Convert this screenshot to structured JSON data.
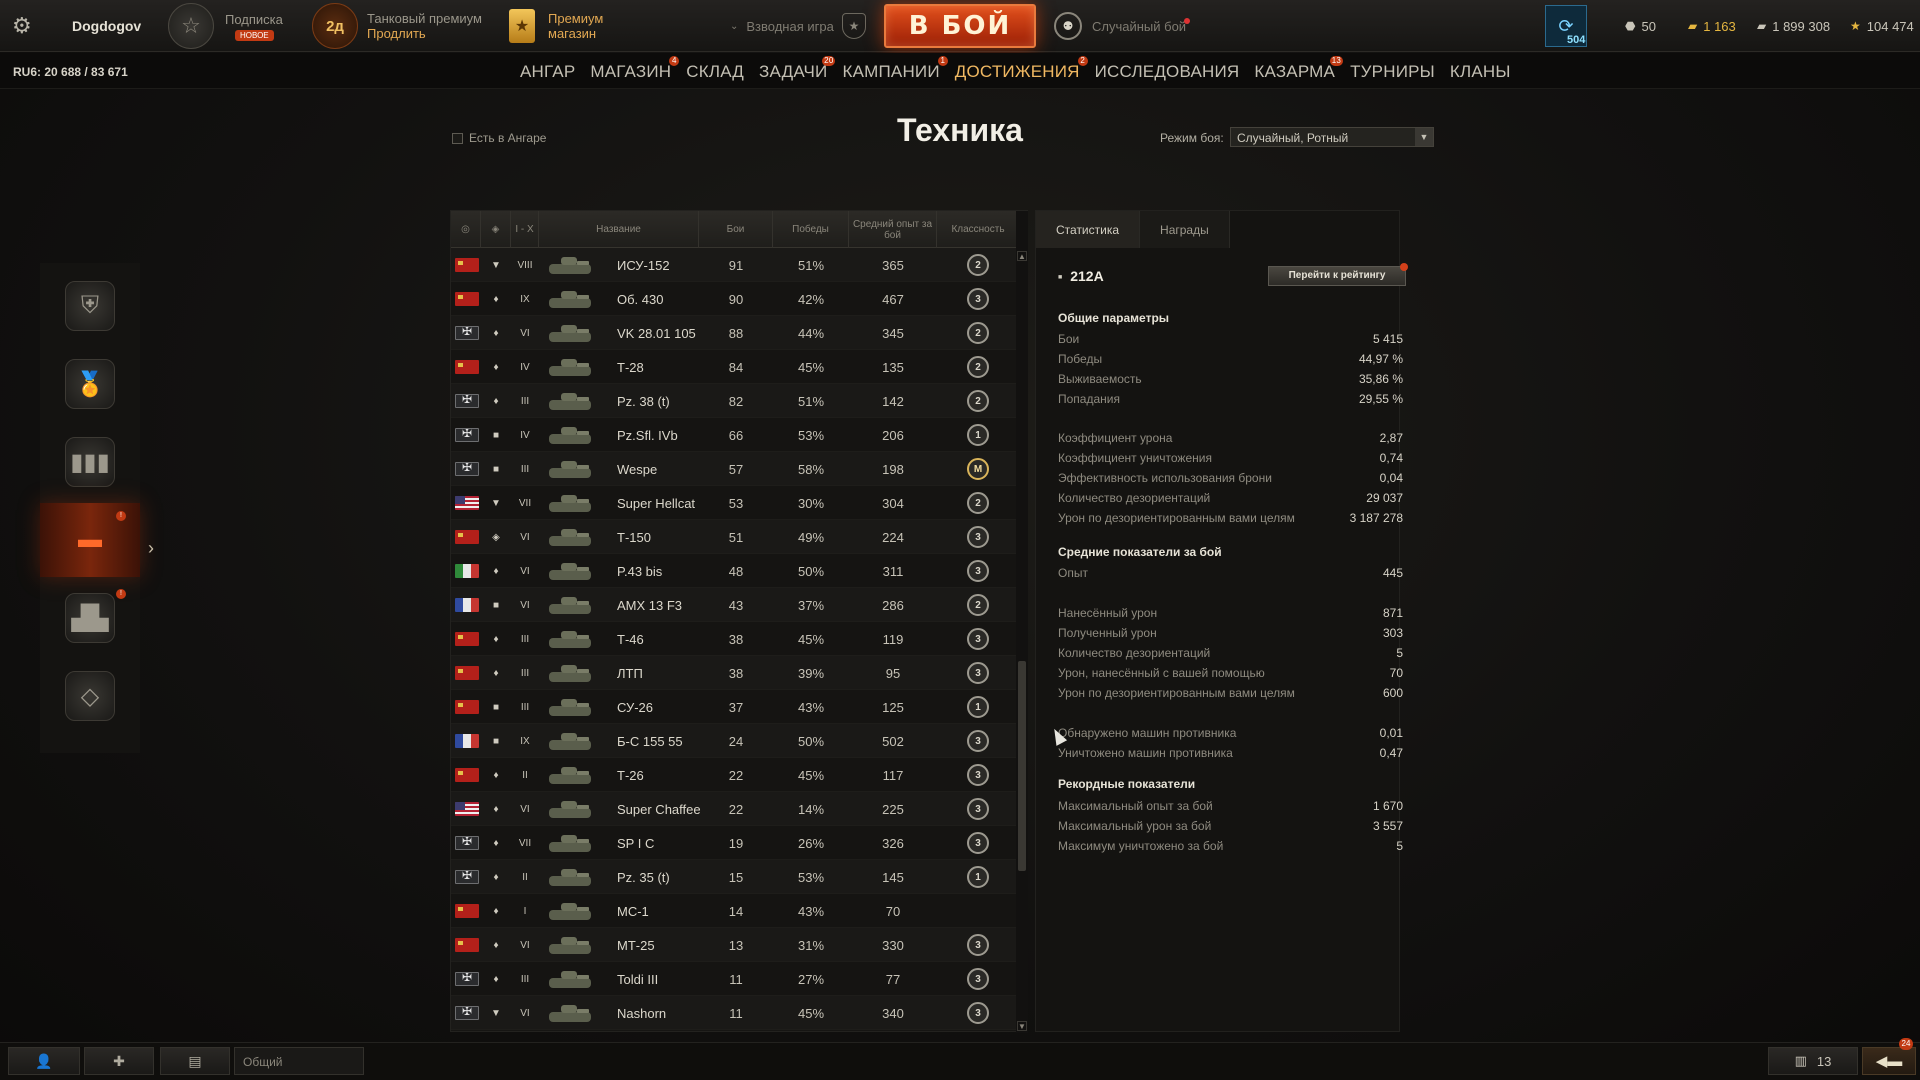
{
  "topbar": {
    "username": "Dogdogov",
    "subscription_label": "Подписка",
    "subscription_badge": "НОВОЕ",
    "premium_days": "2д",
    "premium_label": "Танковый премиум",
    "premium_action": "Продлить",
    "shop_line1": "Премиум",
    "shop_line2": "магазин",
    "platoon_label": "Взводная игра",
    "battle_button": "В БОЙ",
    "battle_mode": "Случайный бой",
    "session_count": "504",
    "currencies": [
      {
        "symbol": "⬣",
        "value": "50",
        "color": "#c9c5b9"
      },
      {
        "symbol": "▰",
        "value": "1 163",
        "color": "#e5b640"
      },
      {
        "symbol": "▰",
        "value": "1 899 308",
        "color": "#c9c5b9"
      },
      {
        "symbol": "★",
        "value": "104 474",
        "color": "#e5b640"
      }
    ]
  },
  "rating_text": "RU6: 20 688 / 83 671",
  "nav": [
    {
      "label": "АНГАР",
      "badge": ""
    },
    {
      "label": "МАГАЗИН",
      "badge": "4"
    },
    {
      "label": "СКЛАД",
      "badge": ""
    },
    {
      "label": "ЗАДАЧИ",
      "badge": "20"
    },
    {
      "label": "КАМПАНИИ",
      "badge": "1"
    },
    {
      "label": "ДОСТИЖЕНИЯ",
      "badge": "2",
      "active": true
    },
    {
      "label": "ИССЛЕДОВАНИЯ",
      "badge": ""
    },
    {
      "label": "КАЗАРМА",
      "badge": "13"
    },
    {
      "label": "ТУРНИРЫ",
      "badge": ""
    },
    {
      "label": "КЛАНЫ",
      "badge": ""
    }
  ],
  "header": {
    "in_hangar_label": "Есть в Ангаре",
    "title": "Техника",
    "mode_label": "Режим боя:",
    "mode_value": "Случайный, Ротный"
  },
  "table": {
    "columns": {
      "tier": "I - X",
      "name": "Название",
      "battles": "Бои",
      "wins": "Победы",
      "avg_xp": "Средний опыт за бой",
      "mastery": "Классность"
    },
    "rows": [
      {
        "nation": "ussr",
        "type": "▼",
        "tier": "VIII",
        "name": "ИСУ-152",
        "battles": "91",
        "wins": "51%",
        "xp": "365",
        "mastery": "2"
      },
      {
        "nation": "ussr",
        "type": "♦",
        "tier": "IX",
        "name": "Об. 430",
        "battles": "90",
        "wins": "42%",
        "xp": "467",
        "mastery": "3"
      },
      {
        "nation": "ger",
        "type": "♦",
        "tier": "VI",
        "name": "VK 28.01 105",
        "battles": "88",
        "wins": "44%",
        "xp": "345",
        "mastery": "2"
      },
      {
        "nation": "ussr",
        "type": "♦",
        "tier": "IV",
        "name": "Т-28",
        "battles": "84",
        "wins": "45%",
        "xp": "135",
        "mastery": "2"
      },
      {
        "nation": "ger",
        "type": "♦",
        "tier": "III",
        "name": "Pz. 38 (t)",
        "battles": "82",
        "wins": "51%",
        "xp": "142",
        "mastery": "2"
      },
      {
        "nation": "ger",
        "type": "■",
        "tier": "IV",
        "name": "Pz.Sfl. IVb",
        "battles": "66",
        "wins": "53%",
        "xp": "206",
        "mastery": "1"
      },
      {
        "nation": "ger",
        "type": "■",
        "tier": "III",
        "name": "Wespe",
        "battles": "57",
        "wins": "58%",
        "xp": "198",
        "mastery": "M"
      },
      {
        "nation": "usa",
        "type": "▼",
        "tier": "VII",
        "name": "Super Hellcat",
        "battles": "53",
        "wins": "30%",
        "xp": "304",
        "mastery": "2"
      },
      {
        "nation": "ussr",
        "type": "◈",
        "tier": "VI",
        "name": "Т-150",
        "battles": "51",
        "wins": "49%",
        "xp": "224",
        "mastery": "3"
      },
      {
        "nation": "ita",
        "type": "♦",
        "tier": "VI",
        "name": "P.43 bis",
        "battles": "48",
        "wins": "50%",
        "xp": "311",
        "mastery": "3"
      },
      {
        "nation": "fra",
        "type": "■",
        "tier": "VI",
        "name": "AMX 13 F3",
        "battles": "43",
        "wins": "37%",
        "xp": "286",
        "mastery": "2"
      },
      {
        "nation": "ussr",
        "type": "♦",
        "tier": "III",
        "name": "Т-46",
        "battles": "38",
        "wins": "45%",
        "xp": "119",
        "mastery": "3"
      },
      {
        "nation": "ussr",
        "type": "♦",
        "tier": "III",
        "name": "ЛТП",
        "battles": "38",
        "wins": "39%",
        "xp": "95",
        "mastery": "3"
      },
      {
        "nation": "ussr",
        "type": "■",
        "tier": "III",
        "name": "СУ-26",
        "battles": "37",
        "wins": "43%",
        "xp": "125",
        "mastery": "1"
      },
      {
        "nation": "fra",
        "type": "■",
        "tier": "IX",
        "name": "Б-С 155 55",
        "battles": "24",
        "wins": "50%",
        "xp": "502",
        "mastery": "3"
      },
      {
        "nation": "ussr",
        "type": "♦",
        "tier": "II",
        "name": "Т-26",
        "battles": "22",
        "wins": "45%",
        "xp": "117",
        "mastery": "3"
      },
      {
        "nation": "usa",
        "type": "♦",
        "tier": "VI",
        "name": "Super Chaffee",
        "battles": "22",
        "wins": "14%",
        "xp": "225",
        "mastery": "3"
      },
      {
        "nation": "ger",
        "type": "♦",
        "tier": "VII",
        "name": "SP I C",
        "battles": "19",
        "wins": "26%",
        "xp": "326",
        "mastery": "3"
      },
      {
        "nation": "ger",
        "type": "♦",
        "tier": "II",
        "name": "Pz. 35 (t)",
        "battles": "15",
        "wins": "53%",
        "xp": "145",
        "mastery": "1"
      },
      {
        "nation": "ussr",
        "type": "♦",
        "tier": "I",
        "name": "МС-1",
        "battles": "14",
        "wins": "43%",
        "xp": "70",
        "mastery": ""
      },
      {
        "nation": "ussr",
        "type": "♦",
        "tier": "VI",
        "name": "МТ-25",
        "battles": "13",
        "wins": "31%",
        "xp": "330",
        "mastery": "3"
      },
      {
        "nation": "ger",
        "type": "♦",
        "tier": "III",
        "name": "Toldi III",
        "battles": "11",
        "wins": "27%",
        "xp": "77",
        "mastery": "3"
      },
      {
        "nation": "ger",
        "type": "▼",
        "tier": "VI",
        "name": "Nashorn",
        "battles": "11",
        "wins": "45%",
        "xp": "340",
        "mastery": "3"
      }
    ]
  },
  "panel": {
    "tab_stats": "Статистика",
    "tab_awards": "Награды",
    "vehicle": "212A",
    "rating_button": "Перейти к рейтингу",
    "general_title": "Общие параметры",
    "general": [
      {
        "label": "Бои",
        "value": "5 415"
      },
      {
        "label": "Победы",
        "value": "44,97 %"
      },
      {
        "label": "Выживаемость",
        "value": "35,86 %"
      },
      {
        "label": "Попадания",
        "value": "29,55 %"
      }
    ],
    "coeffs": [
      {
        "label": "Коэффициент урона",
        "value": "2,87"
      },
      {
        "label": "Коэффициент уничтожения",
        "value": "0,74"
      },
      {
        "label": "Эффективность использования брони",
        "value": "0,04"
      },
      {
        "label": "Количество дезориентаций",
        "value": "29 037"
      },
      {
        "label": "Урон по дезориентированным вами целям",
        "value": "3 187 278"
      }
    ],
    "avg_title": "Средние показатели за бой",
    "avg_xp": {
      "label": "Опыт",
      "value": "445"
    },
    "avg_dmg": [
      {
        "label": "Нанесённый урон",
        "value": "871"
      },
      {
        "label": "Полученный урон",
        "value": "303"
      },
      {
        "label": "Количество дезориентаций",
        "value": "5"
      },
      {
        "label": "Урон, нанесённый с вашей помощью",
        "value": "70"
      },
      {
        "label": "Урон по дезориентированным вами целям",
        "value": "600"
      }
    ],
    "avg_spot": [
      {
        "label": "Обнаружено машин противника",
        "value": "0,01"
      },
      {
        "label": "Уничтожено машин противника",
        "value": "0,47"
      }
    ],
    "record_title": "Рекордные показатели",
    "records": [
      {
        "label": "Максимальный опыт за бой",
        "value": "1 670"
      },
      {
        "label": "Максимальный урон за бой",
        "value": "3 557"
      },
      {
        "label": "Максимум уничтожено за бой",
        "value": "5"
      }
    ]
  },
  "bottombar": {
    "chat_channel": "Общий",
    "online_count": "13",
    "notif_count": "24"
  }
}
